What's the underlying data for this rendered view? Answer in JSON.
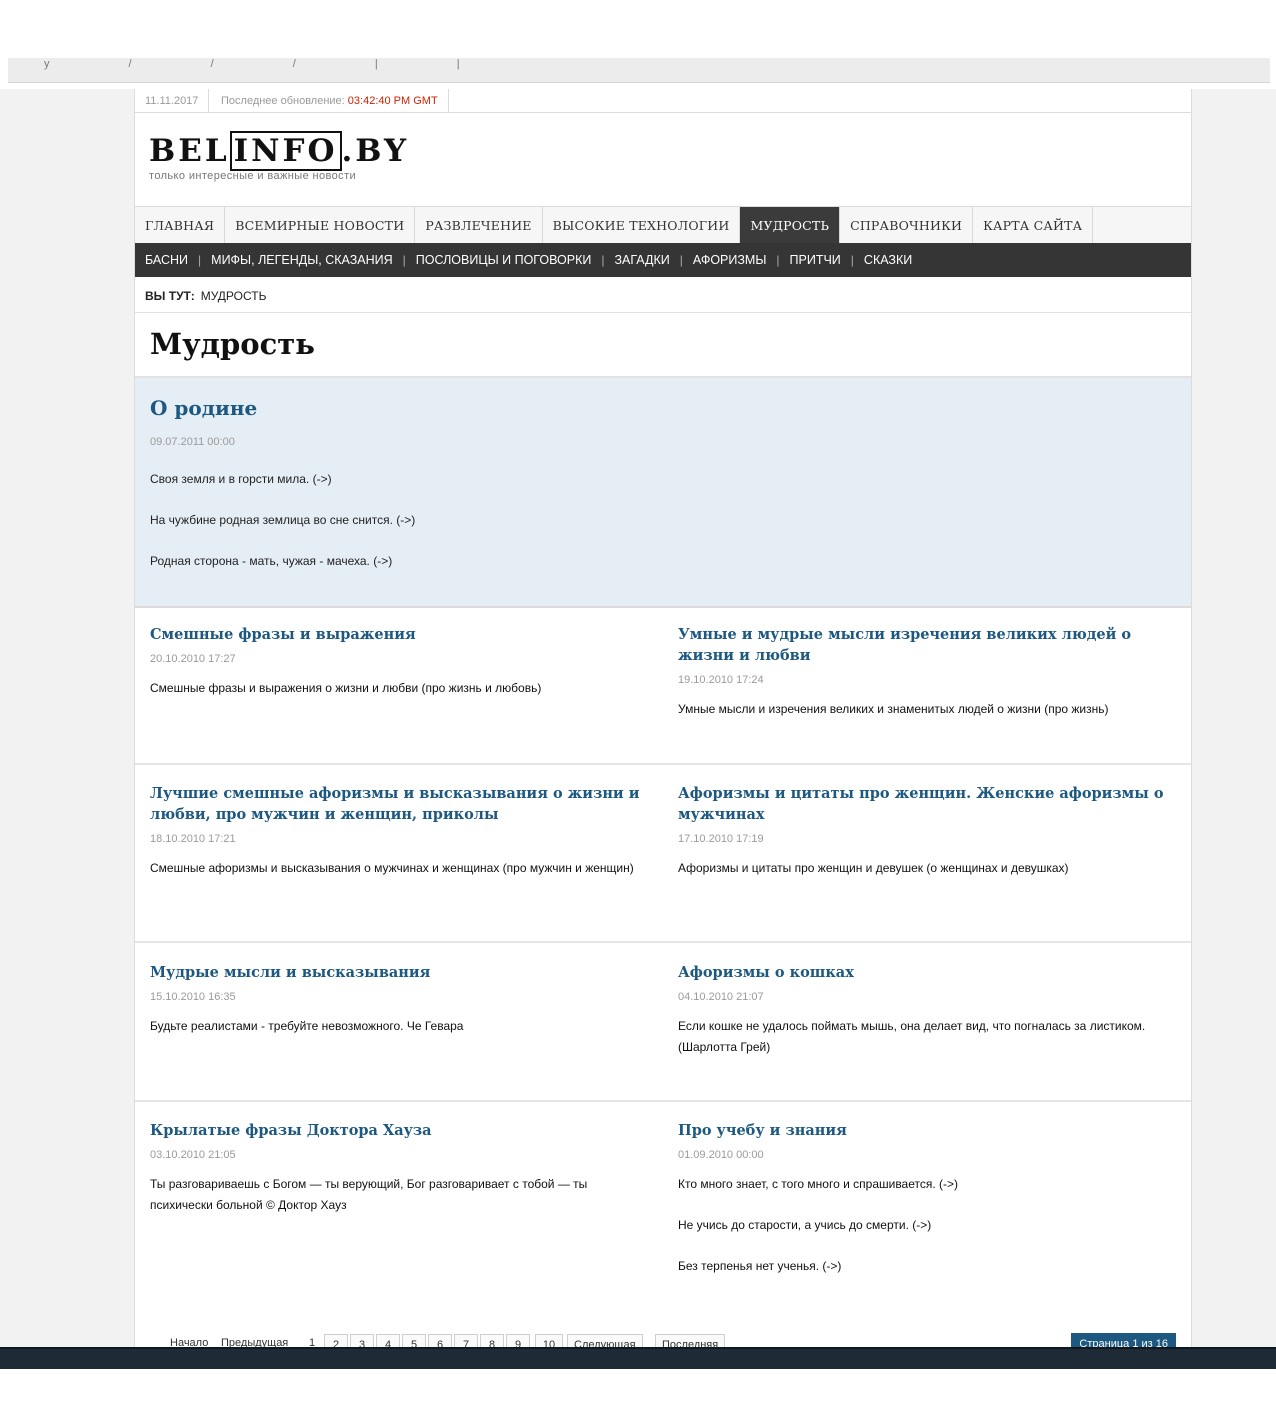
{
  "browser": {
    "crumbs": "y / / / | |"
  },
  "datebar": {
    "date": "11.11.2017",
    "update_label": "Последнее обновление:",
    "update_time": "03:42:40 PM GMT"
  },
  "logo": {
    "part1": "BEL",
    "part2": "INFO",
    "part3": ".BY",
    "tagline": "только интересные и важные новости"
  },
  "mainnav": [
    {
      "label": "Главная"
    },
    {
      "label": "Всемирные новости"
    },
    {
      "label": "Развлечение"
    },
    {
      "label": "Высокие технологии"
    },
    {
      "label": "Мудрость",
      "active": true
    },
    {
      "label": "Справочники"
    },
    {
      "label": "Карта сайта"
    }
  ],
  "subnav": [
    "Басни",
    "Мифы, легенды, сказания",
    "Пословицы и поговорки",
    "Загадки",
    "Афоризмы",
    "Притчи",
    "Сказки"
  ],
  "subnav_sep": "|",
  "breadcrumb": {
    "label": "ВЫ ТУТ:",
    "current": "МУДРОСТЬ"
  },
  "page_title": "Мудрость",
  "featured": {
    "title": "О родине",
    "date": "09.07.2011 00:00",
    "lines": [
      "Своя земля и в горсти мила. (->)",
      "На чужбине родная землица во сне снится. (->)",
      "Родная сторона - мать, чужая - мачеха. (->)"
    ]
  },
  "articles": [
    {
      "title": "Смешные фразы и выражения",
      "date": "20.10.2010 17:27",
      "text": "Смешные фразы и выражения о жизни и любви (про жизнь и любовь)"
    },
    {
      "title": "Умные и мудрые мысли изречения великих людей о жизни и любви",
      "date": "19.10.2010 17:24",
      "text": "Умные мысли и изречения великих и знаменитых людей о жизни (про жизнь)"
    },
    {
      "title": "Лучшие смешные афоризмы и высказывания о жизни и любви, про мужчин и женщин, приколы",
      "date": "18.10.2010 17:21",
      "text": "Смешные афоризмы и высказывания о мужчинах и женщинах (про мужчин и женщин)"
    },
    {
      "title": "Афоризмы и цитаты про женщин. Женские афоризмы о мужчинах",
      "date": "17.10.2010 17:19",
      "text": "Афоризмы и цитаты про женщин и девушек (о женщинах и девушках)"
    },
    {
      "title": "Мудрые мысли и высказывания",
      "date": "15.10.2010 16:35",
      "text": "Будьте реалистами - требуйте невозможного. Че Гевара"
    },
    {
      "title": "Афоризмы о кошках",
      "date": "04.10.2010 21:07",
      "text": "Если кошке не удалось поймать мышь, она делает вид, что погналась за листиком. (Шарлотта Грей)"
    },
    {
      "title": "Крылатые фразы Доктора Хауза",
      "date": "03.10.2010 21:05",
      "text": "Ты разговариваешь с Богом — ты верующий, Бог разговаривает с тобой — ты психически больной © Доктор Хауз"
    },
    {
      "title": "Про учебу и знания",
      "date": "01.09.2010 00:00",
      "lines": [
        "Кто много знает, с того много и спрашивается. (->)",
        "Не учись до старости, а учись до смерти. (->)",
        "Без терпенья нет ученья. (->)"
      ]
    }
  ],
  "pager": {
    "start": "Начало",
    "prev": "Предыдущая",
    "current": "1",
    "pages": [
      "2",
      "3",
      "4",
      "5",
      "6",
      "7",
      "8",
      "9",
      "10"
    ],
    "next": "Следующая",
    "last": "Последняя",
    "count": "Страница 1 из 16"
  },
  "colors": {
    "link": "#1d5880",
    "featured_bg": "#e6eef5",
    "nav_active": "#3b3b3b",
    "subnav_bg": "#353535",
    "update_time": "#cc2200"
  }
}
